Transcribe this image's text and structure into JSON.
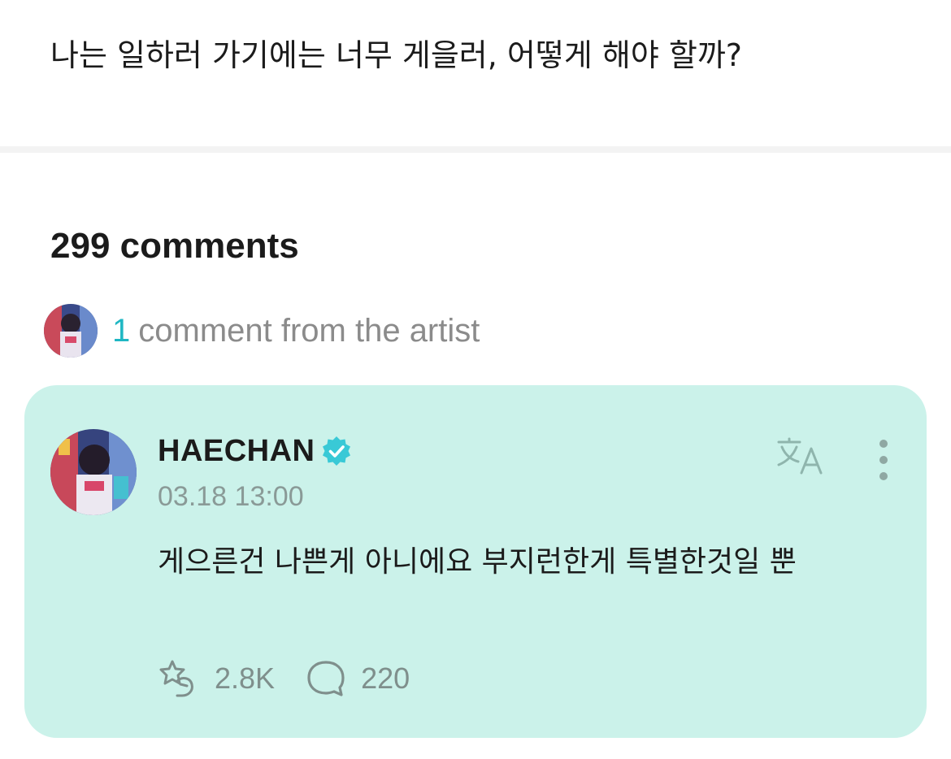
{
  "post": {
    "text": "나는 일하러 가기에는 너무 게을러, 어떻게 해야 할까?"
  },
  "comments": {
    "count_label": "299 comments",
    "artist_count": "1",
    "artist_label": "comment from the artist"
  },
  "artist_comment": {
    "username": "HAECHAN",
    "verified_icon": "verified-check-icon",
    "timestamp": "03.18 13:00",
    "body": "게으른건 나쁜게 아니에요 부지런한게 특별한것일 뿐",
    "translate_icon": "translate-icon",
    "more_icon": "vertical-dots-icon",
    "like_icon": "star-hand-icon",
    "likes": "2.8K",
    "reply_icon": "speech-bubble-icon",
    "replies": "220"
  },
  "colors": {
    "card_background": "#cbf2ea",
    "accent": "#1fb7c3",
    "verified": "#39c9d6",
    "muted_text": "#8b8b8b"
  }
}
